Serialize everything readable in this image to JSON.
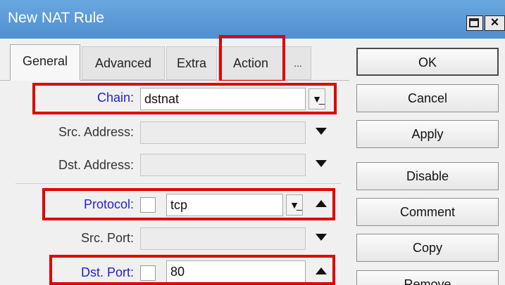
{
  "window": {
    "title": "New NAT Rule"
  },
  "tabs": [
    {
      "label": "General"
    },
    {
      "label": "Advanced"
    },
    {
      "label": "Extra"
    },
    {
      "label": "Action"
    },
    {
      "label": "..."
    }
  ],
  "form": {
    "chain": {
      "label": "Chain:",
      "value": "dstnat"
    },
    "src_address": {
      "label": "Src. Address:",
      "value": ""
    },
    "dst_address": {
      "label": "Dst. Address:",
      "value": ""
    },
    "protocol": {
      "label": "Protocol:",
      "value": "tcp"
    },
    "src_port": {
      "label": "Src. Port:",
      "value": ""
    },
    "dst_port": {
      "label": "Dst. Port:",
      "value": "80"
    }
  },
  "buttons": {
    "ok": "OK",
    "cancel": "Cancel",
    "apply": "Apply",
    "disable": "Disable",
    "comment": "Comment",
    "copy": "Copy",
    "remove": "Remove"
  },
  "colors": {
    "title_bar": "#5b9bd9",
    "highlight": "#e00000",
    "label_blue": "#1f1fd0"
  }
}
